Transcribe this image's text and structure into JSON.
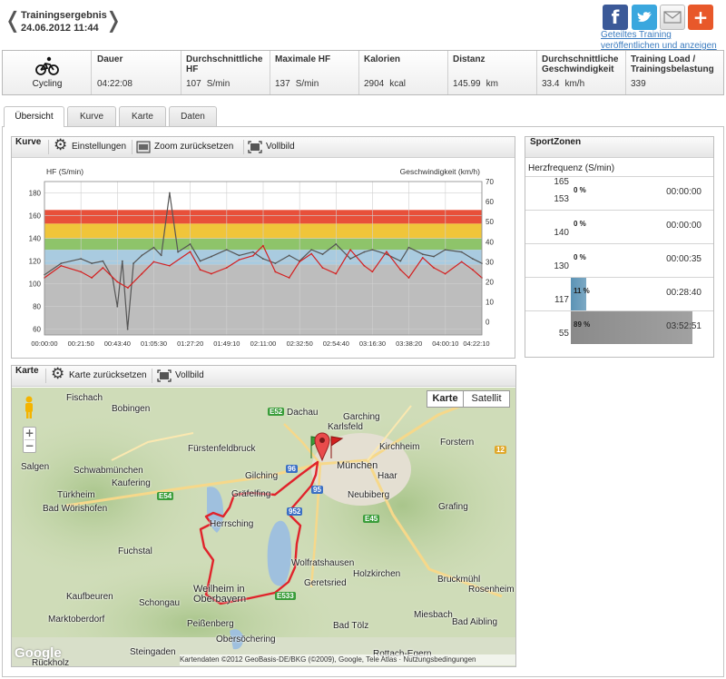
{
  "header": {
    "prev_arrow": "❬",
    "next_arrow": "❭",
    "title": "Trainingsergebnis",
    "date": "24.06.2012 11:44",
    "share_link": "Geteiltes Training veröffentlichen und anzeigen",
    "share_icons": [
      "facebook-icon",
      "twitter-icon",
      "email-icon",
      "add-icon"
    ]
  },
  "summary": {
    "sport": "Cycling",
    "cells": [
      {
        "label": "Dauer",
        "value": "04:22:08",
        "unit": ""
      },
      {
        "label": "Durchschnittliche HF",
        "value": "107",
        "unit": "S/min"
      },
      {
        "label": "Maximale HF",
        "value": "137",
        "unit": "S/min"
      },
      {
        "label": "Kalorien",
        "value": "2904",
        "unit": "kcal"
      },
      {
        "label": "Distanz",
        "value": "145.99",
        "unit": "km"
      },
      {
        "label": "Durchschnittliche Geschwindigkeit",
        "value": "33.4",
        "unit": "km/h"
      },
      {
        "label": "Training Load / Trainingsbelastung",
        "value": "339",
        "unit": ""
      }
    ]
  },
  "tabs": [
    {
      "label": "Übersicht",
      "active": true
    },
    {
      "label": "Kurve",
      "active": false
    },
    {
      "label": "Karte",
      "active": false
    },
    {
      "label": "Daten",
      "active": false
    }
  ],
  "curve_panel": {
    "title": "Kurve",
    "settings": "Einstellungen",
    "zoom_reset": "Zoom zurücksetzen",
    "fullscreen": "Vollbild"
  },
  "chart_data": {
    "type": "line",
    "ylabel": "HF (S/min)",
    "y2label": "Geschwindigkeit (km/h)",
    "ylim": [
      55,
      190
    ],
    "y2lim": [
      -6.5,
      70
    ],
    "yticks": [
      60,
      80,
      100,
      120,
      140,
      160,
      180
    ],
    "y2ticks": [
      0,
      10,
      20,
      30,
      40,
      50,
      60,
      70
    ],
    "xlim_s": [
      0,
      15728
    ],
    "xticks": [
      "00:00:00",
      "00:21:50",
      "00:43:40",
      "01:05:30",
      "01:27:20",
      "01:49:10",
      "02:11:00",
      "02:32:50",
      "02:54:40",
      "03:16:30",
      "03:38:20",
      "04:00:10",
      "04:22:10"
    ],
    "grid": true,
    "zones": [
      {
        "from": 55,
        "to": 117,
        "color": "#bdbdbd"
      },
      {
        "from": 117,
        "to": 130,
        "color": "#a9cbe0"
      },
      {
        "from": 130,
        "to": 140,
        "color": "#8ec46a"
      },
      {
        "from": 140,
        "to": 153,
        "color": "#f0c53a"
      },
      {
        "from": 153,
        "to": 165,
        "color": "#e8503a"
      }
    ],
    "series": [
      {
        "axis": "y",
        "color": "#555555",
        "x_s": [
          0,
          600,
          1310,
          1700,
          2100,
          2450,
          2620,
          2800,
          2990,
          3200,
          3500,
          3930,
          4200,
          4500,
          4800,
          5240,
          5600,
          6000,
          6550,
          7000,
          7500,
          7860,
          8300,
          8800,
          9170,
          9600,
          10000,
          10480,
          11000,
          11500,
          11790,
          12300,
          12800,
          13100,
          13600,
          14000,
          14410,
          15000,
          15400,
          15728
        ],
        "values": [
          108,
          118,
          122,
          118,
          120,
          105,
          80,
          120,
          60,
          118,
          125,
          132,
          125,
          180,
          128,
          135,
          120,
          124,
          130,
          125,
          128,
          122,
          118,
          125,
          120,
          130,
          126,
          135,
          122,
          128,
          130,
          126,
          120,
          132,
          126,
          124,
          130,
          128,
          122,
          118
        ]
      },
      {
        "axis": "y2",
        "color": "#d42020",
        "x_s": [
          0,
          600,
          1310,
          1700,
          2100,
          2620,
          3000,
          3500,
          3930,
          4500,
          5240,
          5600,
          6000,
          6550,
          7000,
          7500,
          7860,
          8300,
          8800,
          9170,
          9600,
          10000,
          10480,
          11000,
          11500,
          11790,
          12300,
          12800,
          13100,
          13600,
          14000,
          14410,
          15000,
          15400,
          15728
        ],
        "values": [
          22,
          28,
          25,
          22,
          27,
          20,
          17,
          24,
          30,
          28,
          35,
          26,
          24,
          27,
          31,
          33,
          38,
          25,
          22,
          30,
          34,
          27,
          24,
          36,
          28,
          25,
          35,
          26,
          22,
          32,
          27,
          24,
          30,
          26,
          22
        ]
      }
    ]
  },
  "sportzones": {
    "title": "SportZonen",
    "subtitle": "Herzfrequenz (S/min)",
    "rows": [
      {
        "hi": "165",
        "lo": "153",
        "pct": "0 %",
        "fraction": 0.0,
        "time": "00:00:00",
        "color": "#d9d9d9"
      },
      {
        "hi": "",
        "lo": "140",
        "pct": "0 %",
        "fraction": 0.0,
        "time": "00:00:00",
        "color": "#d9d9d9"
      },
      {
        "hi": "",
        "lo": "130",
        "pct": "0 %",
        "fraction": 0.0,
        "time": "00:00:35",
        "color": "#d9d9d9"
      },
      {
        "hi": "",
        "lo": "117",
        "pct": "11 %",
        "fraction": 0.11,
        "time": "00:28:40",
        "color": "#5b93b5"
      },
      {
        "hi": "",
        "lo": "55",
        "pct": "89 %",
        "fraction": 0.89,
        "time": "03:52:51",
        "color": "#8a8a8a"
      }
    ]
  },
  "map_panel": {
    "title": "Karte",
    "reset": "Karte zurücksetzen",
    "fullscreen": "Vollbild",
    "type_map": "Karte",
    "type_satellite": "Satellit",
    "zoom_in": "+",
    "zoom_out": "−",
    "logo": "Google",
    "attribution": "Kartendaten ©2012 GeoBasis-DE/BKG (©2009), Google, Tele Atlas · Nutzungsbedingungen",
    "cities": [
      "Fischach",
      "Bobingen",
      "Dachau",
      "Karlsfeld",
      "Garching",
      "Schwabmünchen",
      "Fürstenfeldbruck",
      "Kirchheim",
      "Forstern",
      "Salgen",
      "Kaufering",
      "Gilching",
      "München",
      "Haar",
      "Gräfelfing",
      "Neubiberg",
      "Türkheim",
      "Bad Wörishofen",
      "Herrsching",
      "Grafing",
      "Fuchstal",
      "Wolfratshausen",
      "Kaufbeuren",
      "Geretsried",
      "Holzkirchen",
      "Bruckmühl",
      "Schongau",
      "Weilheim in Oberbayern",
      "Rosenheim",
      "Marktoberdorf",
      "Peißenberg",
      "Miesbach",
      "Bad Aibling",
      "Bad Tölz",
      "Obersöchering",
      "Steingaden",
      "Rückholz",
      "Rottach-Egern"
    ],
    "roads": [
      "E52",
      "96",
      "95",
      "E54",
      "952",
      "E45",
      "E533",
      "12"
    ]
  }
}
